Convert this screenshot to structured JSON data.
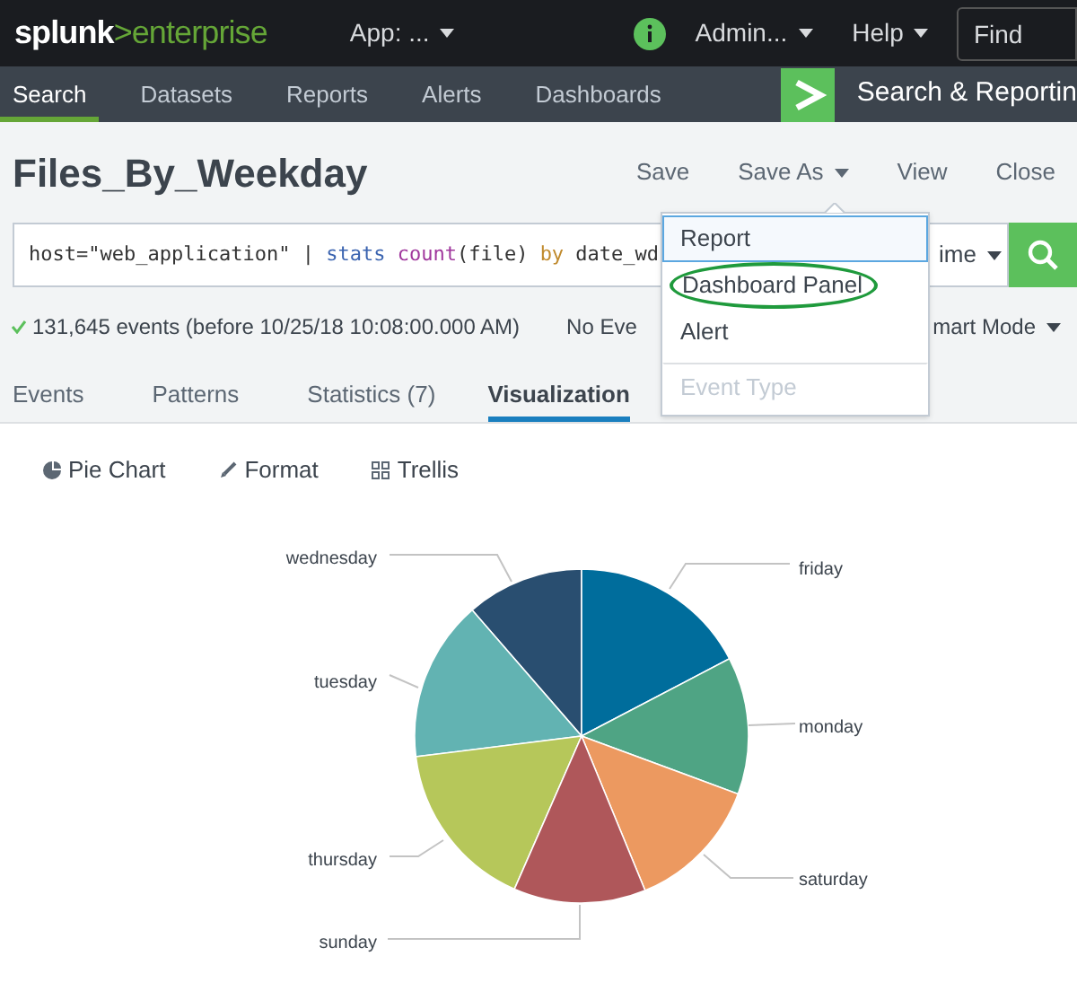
{
  "top_bar": {
    "logo_brand": "splunk",
    "logo_product": ">enterprise",
    "app_menu": "App: ...",
    "admin_menu": "Admin...",
    "help_menu": "Help",
    "find": {
      "placeholder": "Find"
    }
  },
  "nav": {
    "tabs": [
      {
        "label": "Search",
        "selected": true
      },
      {
        "label": "Datasets",
        "selected": false
      },
      {
        "label": "Reports",
        "selected": false
      },
      {
        "label": "Alerts",
        "selected": false
      },
      {
        "label": "Dashboards",
        "selected": false
      }
    ],
    "app_title": "Search & Reportin"
  },
  "header": {
    "title": "Files_By_Weekday",
    "actions": [
      {
        "label": "Save",
        "kind": "button"
      },
      {
        "label": "Save As",
        "kind": "menu"
      },
      {
        "label": "View",
        "kind": "button"
      },
      {
        "label": "Close",
        "kind": "button"
      }
    ]
  },
  "search": {
    "query": [
      {
        "text": "host=\"web_application\" | ",
        "kind": "plain"
      },
      {
        "text": "stats ",
        "kind": "command"
      },
      {
        "text": "count",
        "kind": "function"
      },
      {
        "text": "(file) ",
        "kind": "plain"
      },
      {
        "text": "by",
        "kind": "keyword"
      },
      {
        "text": " date_wd",
        "kind": "plain"
      }
    ],
    "time_picker": "ime"
  },
  "status": {
    "events": "131,645 events (before 10/25/18 10:08:00.000 AM)",
    "event_sampling": "No Eve",
    "search_mode": "mart Mode"
  },
  "result_tabs": [
    {
      "label": "Events",
      "selected": false
    },
    {
      "label": "Patterns",
      "selected": false
    },
    {
      "label": "Statistics (7)",
      "selected": false
    },
    {
      "label": "Visualization",
      "selected": true
    }
  ],
  "viz_toolbar": [
    {
      "label": "Pie Chart",
      "kind": "pie"
    },
    {
      "label": "Format",
      "kind": "format"
    },
    {
      "label": "Trellis",
      "kind": "trellis"
    }
  ],
  "pie": {
    "slices": [
      {
        "label": "wednesday",
        "color": "#294e70"
      },
      {
        "label": "friday",
        "color": "#006d9c"
      },
      {
        "label": "tuesday",
        "color": "#62b3b2"
      },
      {
        "label": "monday",
        "color": "#4fa484"
      },
      {
        "label": "thursday",
        "color": "#b6c75a"
      },
      {
        "label": "saturday",
        "color": "#ec9960"
      },
      {
        "label": "sunday",
        "color": "#af575a"
      }
    ]
  },
  "save_as_menu": {
    "items": [
      {
        "label": "Report",
        "selected": true,
        "disabled": false,
        "circled": false,
        "separated": false
      },
      {
        "label": "Dashboard Panel",
        "selected": false,
        "disabled": false,
        "circled": true,
        "separated": false
      },
      {
        "label": "Alert",
        "selected": false,
        "disabled": false,
        "circled": false,
        "separated": false
      },
      {
        "label": "Event Type",
        "selected": false,
        "disabled": true,
        "circled": false,
        "separated": true
      }
    ]
  }
}
